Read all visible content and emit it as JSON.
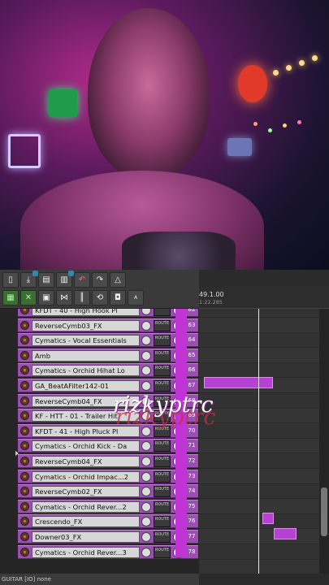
{
  "photo": {
    "description_icon": "portrait-photo"
  },
  "toolbar": {
    "buttons": [
      "new-project",
      "open",
      "save",
      "undo",
      "redo",
      "metronome",
      "grid",
      "snap",
      "ripple",
      "mixer",
      "loop",
      "lock",
      "auto"
    ]
  },
  "ruler": {
    "measure": "49.1.00",
    "time": "1:22.285"
  },
  "tracks": [
    {
      "name": "KFDT - 40 - High Hook Pl",
      "num": "62"
    },
    {
      "name": "ReverseCymb03_FX",
      "num": "63"
    },
    {
      "name": "Cymatics - Vocal Essentials",
      "num": "64"
    },
    {
      "name": "Amb",
      "num": "65"
    },
    {
      "name": "Cymatics - Orchid Hihat Lo",
      "num": "66"
    },
    {
      "name": "GA_BeatAFilter142-01",
      "num": "67"
    },
    {
      "name": "ReverseCymb04_FX",
      "num": "68"
    },
    {
      "name": "KF - HTT - 01 - Trailer Hit",
      "num": "69"
    },
    {
      "name": "KFDT - 41 - High Pluck Pl",
      "num": "70"
    },
    {
      "name": "Cymatics - Orchid Kick - Da",
      "num": "71"
    },
    {
      "name": "ReverseCymb04_FX",
      "num": "72"
    },
    {
      "name": "Cymatics - Orchid Impac...2",
      "num": "73"
    },
    {
      "name": "ReverseCymb02_FX",
      "num": "74"
    },
    {
      "name": "Cymatics - Orchid Rever...2",
      "num": "75"
    },
    {
      "name": "Crescendo_FX",
      "num": "76"
    },
    {
      "name": "Downer03_FX",
      "num": "77"
    },
    {
      "name": "Cymatics - Orchid Rever...3",
      "num": "78"
    }
  ],
  "route_label": "ROUTE",
  "status": {
    "text": "GUITAR [IO] none"
  },
  "watermark": {
    "text": "rizkyptrc"
  },
  "colors": {
    "track": "#9b4fb3",
    "item": "#b542d1",
    "meter": "#c233d6"
  }
}
